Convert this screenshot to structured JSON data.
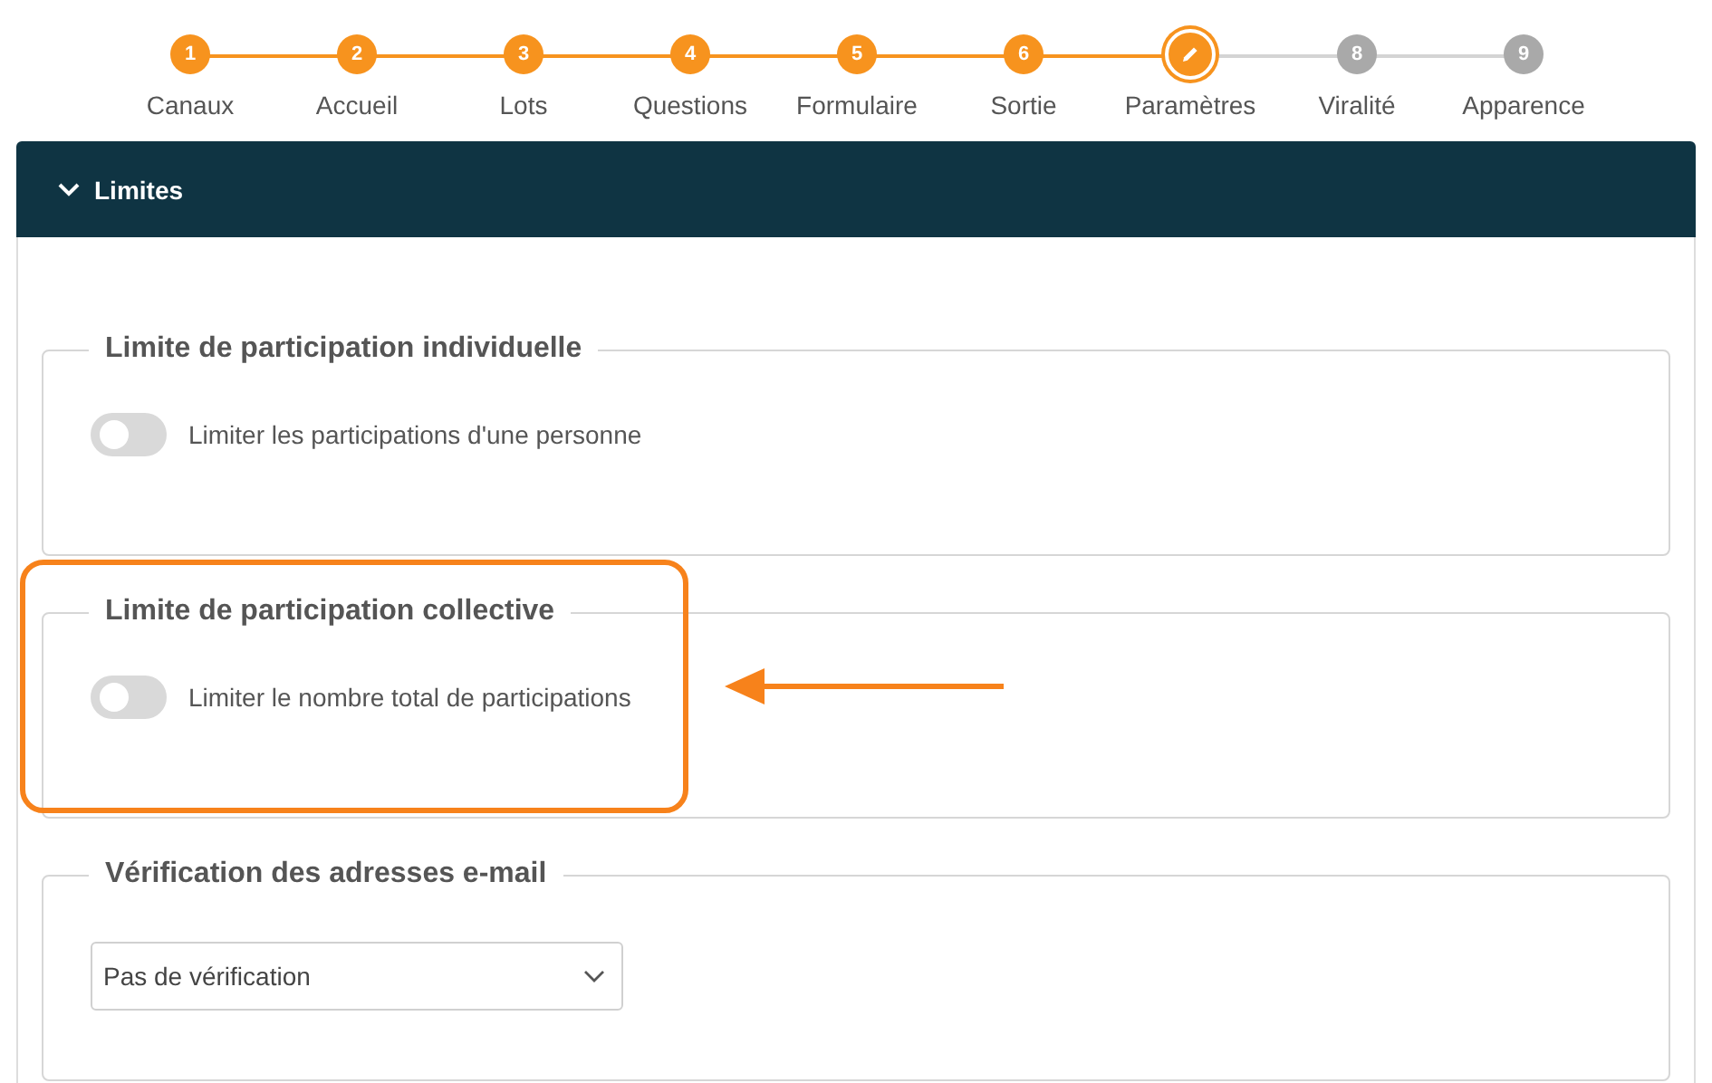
{
  "steps": [
    {
      "number": "1",
      "label": "Canaux",
      "completed": true,
      "selected": false
    },
    {
      "number": "2",
      "label": "Accueil",
      "completed": true,
      "selected": false
    },
    {
      "number": "3",
      "label": "Lots",
      "completed": true,
      "selected": false
    },
    {
      "number": "4",
      "label": "Questions",
      "completed": true,
      "selected": false
    },
    {
      "number": "5",
      "label": "Formulaire",
      "completed": true,
      "selected": false
    },
    {
      "number": "6",
      "label": "Sortie",
      "completed": true,
      "selected": false
    },
    {
      "label": "Paramètres",
      "selected": true
    },
    {
      "number": "8",
      "label": "Viralité",
      "completed": false,
      "selected": false
    },
    {
      "number": "9",
      "label": "Apparence",
      "completed": false,
      "selected": false
    }
  ],
  "section": {
    "title": "Limites",
    "expanded": true,
    "groups": [
      {
        "kind": "toggle",
        "legend": "Limite de participation individuelle",
        "label": "Limiter les participations d'une personne",
        "on": false
      },
      {
        "kind": "toggle",
        "legend": "Limite de participation collective",
        "label": "Limiter le nombre total de participations",
        "on": false,
        "highlighted": true,
        "arrow": true
      },
      {
        "kind": "select",
        "legend": "Vérification des adresses e-mail",
        "value": "Pas de vérification"
      }
    ]
  }
}
